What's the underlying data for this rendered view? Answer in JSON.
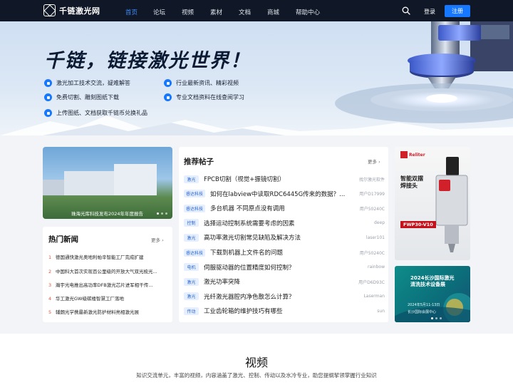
{
  "brand": {
    "name": "千链激光网"
  },
  "nav": {
    "links": [
      "首页",
      "论坛",
      "视频",
      "素材",
      "文档",
      "商城",
      "帮助中心"
    ],
    "login": "登录",
    "register": "注册"
  },
  "hero": {
    "title": "千链，链接激光世界！",
    "features": [
      "激光加工技术交流，疑难解答",
      "行业最新资讯、精彩视频",
      "免费切割、雕刻图纸下载",
      "专业文档资料在线查阅学习",
      "上传图纸、文档获取千链币兑换礼品"
    ]
  },
  "news": {
    "banner_caption": "珠海光库科技发布2024年年度报告",
    "title": "热门新闻",
    "more": "更多",
    "items": [
      {
        "num": "1",
        "text": "德国通快激光奥地利帕辛智能工厂完成扩建"
      },
      {
        "num": "2",
        "text": "中国科大首次实现百公里级的开放大气双光梳光..."
      },
      {
        "num": "3",
        "text": "瀚宇光电推出高功率DFB激光芯片进军相干传..."
      },
      {
        "num": "4",
        "text": "华工激光GW级碳楼智慧工厂落地"
      },
      {
        "num": "5",
        "text": "辅朗光学携最新激光防护材料亮相激光展"
      }
    ]
  },
  "posts": {
    "title": "推荐帖子",
    "more": "更多",
    "items": [
      {
        "tag": "激光",
        "title": "FPCB切割（视觉+振镜切割）",
        "author": "找尔激光软件"
      },
      {
        "tag": "睿达科技",
        "title": "如何在labview中读取RDC6445G传来的数据？...",
        "author": "用户D17999"
      },
      {
        "tag": "睿达科技",
        "title": "多台机器 不同原点没有调用",
        "author": "用户50240C"
      },
      {
        "tag": "控制",
        "title": "选择运动控制系统需要考虑的因素",
        "author": "deep"
      },
      {
        "tag": "激光",
        "title": "高功率激光切割常见缺陷及解决方法",
        "author": "laser101"
      },
      {
        "tag": "睿达科技",
        "title": "下载到机器上文件名的问题",
        "author": "用户50240C"
      },
      {
        "tag": "电机",
        "title": "伺服驱动器的位置精度如何控制？",
        "author": "rainbow"
      },
      {
        "tag": "激光",
        "title": "激光功率突降",
        "author": "用户D6D93C"
      },
      {
        "tag": "激光",
        "title": "光纤激光器腔内净色散怎么计算？",
        "author": "Laserman"
      },
      {
        "tag": "传动",
        "title": "工业齿轮箱的维护技巧有哪些",
        "author": "sun"
      }
    ]
  },
  "ads": {
    "ad1": {
      "brand": "Reliter",
      "headline": "智能双摆\n焊接头",
      "model": "FWP30-V10"
    },
    "ad2": {
      "headline": "2024长沙国际激光\n清洗技术设备展",
      "date": "2024年5月11-13日",
      "venue": "长沙国际会展中心"
    }
  },
  "video": {
    "title": "视频",
    "subtitle": "知识交流单元，丰富的视频，内容涵盖了激光、控制、传动以及水冷专业，助您提纲挈领掌握行业知识"
  },
  "colors": {
    "nav_bg": "#101828",
    "accent": "#1677ff",
    "rank": "#e0533a"
  }
}
